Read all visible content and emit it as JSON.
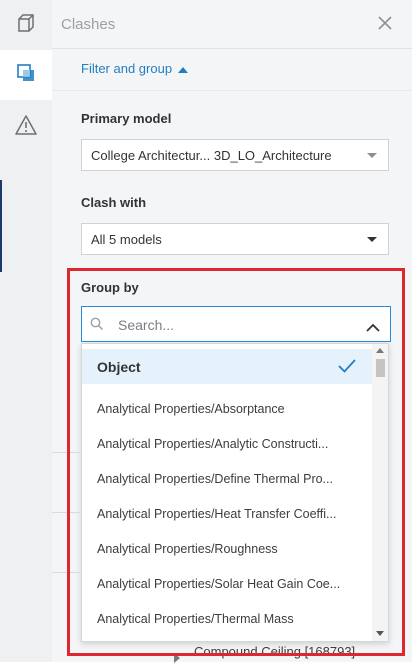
{
  "rail": {
    "items": [
      {
        "icon": "cube-icon"
      },
      {
        "icon": "clashes-icon",
        "active": true
      },
      {
        "icon": "warning-icon"
      }
    ]
  },
  "panel": {
    "title": "Clashes",
    "filter_toggle": "Filter and group",
    "primary_model": {
      "label": "Primary model",
      "value": "College Architectur... 3D_LO_Architecture"
    },
    "clash_with": {
      "label": "Clash with",
      "value": "All 5 models"
    },
    "group_by": {
      "label": "Group by",
      "search_placeholder": "Search...",
      "options": [
        "Object",
        "Analytical Properties/Absorptance",
        "Analytical Properties/Analytic Constructi...",
        "Analytical Properties/Define Thermal Pro...",
        "Analytical Properties/Heat Transfer Coeffi...",
        "Analytical Properties/Roughness",
        "Analytical Properties/Solar Heat Gain Coe...",
        "Analytical Properties/Thermal Mass"
      ],
      "selected_index": 0
    },
    "underlying_row": "Compound Ceiling [168793]"
  },
  "colors": {
    "accent": "#1f7fc3",
    "highlight": "#e0262f",
    "selected_bg": "#e6f2fb"
  }
}
